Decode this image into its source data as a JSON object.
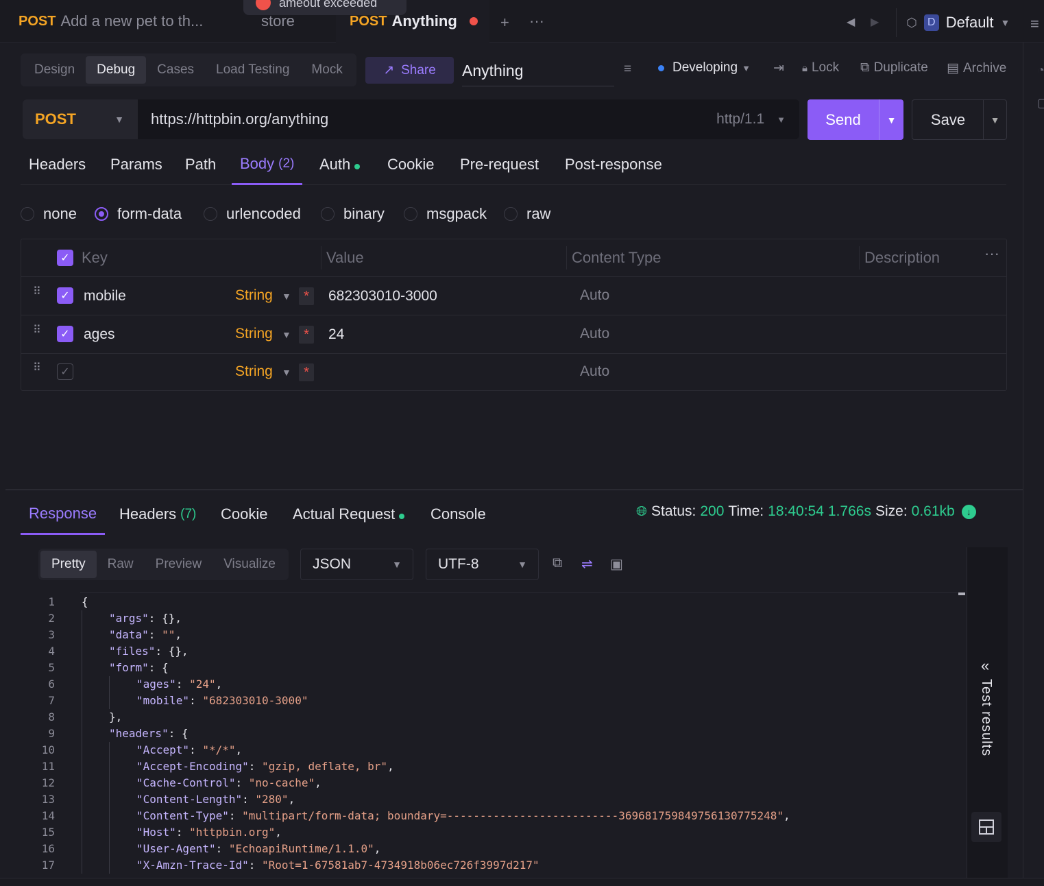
{
  "tabs": [
    {
      "method": "POST",
      "title": "Add a new pet to th...",
      "active": false
    },
    {
      "method": "",
      "title": "store",
      "active": false
    },
    {
      "method": "POST",
      "title": "Anything",
      "active": true,
      "unsaved": true
    }
  ],
  "toast": {
    "text": "ameout exceeded"
  },
  "environment": {
    "badge": "D",
    "name": "Default"
  },
  "modes": [
    "Design",
    "Debug",
    "Cases",
    "Load Testing",
    "Mock"
  ],
  "active_mode": "Debug",
  "share_label": "Share",
  "request_name": "Anything",
  "toolbar": {
    "status": "Developing",
    "lock": "Lock",
    "duplicate": "Duplicate",
    "archive": "Archive"
  },
  "url_bar": {
    "method": "POST",
    "url": "https://httpbin.org/anything",
    "protocol": "http/1.1",
    "send": "Send",
    "save": "Save"
  },
  "request_tabs": [
    {
      "label": "Headers"
    },
    {
      "label": "Params"
    },
    {
      "label": "Path"
    },
    {
      "label": "Body",
      "count": "(2)",
      "active": true
    },
    {
      "label": "Auth",
      "dot": true
    },
    {
      "label": "Cookie"
    },
    {
      "label": "Pre-request"
    },
    {
      "label": "Post-response"
    }
  ],
  "body_types": [
    "none",
    "form-data",
    "urlencoded",
    "binary",
    "msgpack",
    "raw"
  ],
  "body_type_selected": "form-data",
  "form_table": {
    "headers": {
      "key": "Key",
      "value": "Value",
      "content_type": "Content Type",
      "description": "Description"
    },
    "rows": [
      {
        "checked": true,
        "key": "mobile",
        "type": "String",
        "value": "682303010-3000",
        "content_type": "Auto"
      },
      {
        "checked": true,
        "key": "ages",
        "type": "String",
        "value": "24",
        "content_type": "Auto"
      },
      {
        "checked": false,
        "key": "",
        "type": "String",
        "value": "",
        "content_type": "Auto"
      }
    ]
  },
  "response_tabs": [
    {
      "label": "Response",
      "active": true
    },
    {
      "label": "Headers",
      "count": "(7)"
    },
    {
      "label": "Cookie"
    },
    {
      "label": "Actual Request",
      "dot": true
    },
    {
      "label": "Console"
    }
  ],
  "status_bar": {
    "status_label": "Status:",
    "status": "200",
    "time_label": "Time:",
    "time": "18:40:54",
    "duration": "1.766s",
    "size_label": "Size:",
    "size": "0.61kb"
  },
  "view_modes": [
    "Pretty",
    "Raw",
    "Preview",
    "Visualize"
  ],
  "active_view": "Pretty",
  "format": "JSON",
  "encoding": "UTF-8",
  "test_results_label": "Test results",
  "colors": {
    "accent": "#8b5cf6",
    "method": "#f5a524",
    "success": "#2ecc8f",
    "danger": "#f0524a"
  },
  "code_lines": [
    {
      "n": "1",
      "indent": 0,
      "parts": [
        [
          "p",
          "{"
        ]
      ]
    },
    {
      "n": "2",
      "indent": 1,
      "parts": [
        [
          "k",
          "\"args\""
        ],
        [
          "p",
          ": {},"
        ]
      ]
    },
    {
      "n": "3",
      "indent": 1,
      "parts": [
        [
          "k",
          "\"data\""
        ],
        [
          "p",
          ": "
        ],
        [
          "s",
          "\"\""
        ],
        [
          "p",
          ","
        ]
      ]
    },
    {
      "n": "4",
      "indent": 1,
      "parts": [
        [
          "k",
          "\"files\""
        ],
        [
          "p",
          ": {},"
        ]
      ]
    },
    {
      "n": "5",
      "indent": 1,
      "parts": [
        [
          "k",
          "\"form\""
        ],
        [
          "p",
          ": {"
        ]
      ]
    },
    {
      "n": "6",
      "indent": 2,
      "parts": [
        [
          "k",
          "\"ages\""
        ],
        [
          "p",
          ": "
        ],
        [
          "s",
          "\"24\""
        ],
        [
          "p",
          ","
        ]
      ]
    },
    {
      "n": "7",
      "indent": 2,
      "parts": [
        [
          "k",
          "\"mobile\""
        ],
        [
          "p",
          ": "
        ],
        [
          "s",
          "\"682303010-3000\""
        ]
      ]
    },
    {
      "n": "8",
      "indent": 1,
      "parts": [
        [
          "p",
          "},"
        ]
      ]
    },
    {
      "n": "9",
      "indent": 1,
      "parts": [
        [
          "k",
          "\"headers\""
        ],
        [
          "p",
          ": {"
        ]
      ]
    },
    {
      "n": "10",
      "indent": 2,
      "parts": [
        [
          "k",
          "\"Accept\""
        ],
        [
          "p",
          ": "
        ],
        [
          "s",
          "\"*/*\""
        ],
        [
          "p",
          ","
        ]
      ]
    },
    {
      "n": "11",
      "indent": 2,
      "parts": [
        [
          "k",
          "\"Accept-Encoding\""
        ],
        [
          "p",
          ": "
        ],
        [
          "s",
          "\"gzip, deflate, br\""
        ],
        [
          "p",
          ","
        ]
      ]
    },
    {
      "n": "12",
      "indent": 2,
      "parts": [
        [
          "k",
          "\"Cache-Control\""
        ],
        [
          "p",
          ": "
        ],
        [
          "s",
          "\"no-cache\""
        ],
        [
          "p",
          ","
        ]
      ]
    },
    {
      "n": "13",
      "indent": 2,
      "parts": [
        [
          "k",
          "\"Content-Length\""
        ],
        [
          "p",
          ": "
        ],
        [
          "s",
          "\"280\""
        ],
        [
          "p",
          ","
        ]
      ]
    },
    {
      "n": "14",
      "indent": 2,
      "parts": [
        [
          "k",
          "\"Content-Type\""
        ],
        [
          "p",
          ": "
        ],
        [
          "s",
          "\"multipart/form-data; boundary=--------------------------369681759849756130775248\""
        ],
        [
          "p",
          ","
        ]
      ]
    },
    {
      "n": "15",
      "indent": 2,
      "parts": [
        [
          "k",
          "\"Host\""
        ],
        [
          "p",
          ": "
        ],
        [
          "s",
          "\"httpbin.org\""
        ],
        [
          "p",
          ","
        ]
      ]
    },
    {
      "n": "16",
      "indent": 2,
      "parts": [
        [
          "k",
          "\"User-Agent\""
        ],
        [
          "p",
          ": "
        ],
        [
          "s",
          "\"EchoapiRuntime/1.1.0\""
        ],
        [
          "p",
          ","
        ]
      ]
    },
    {
      "n": "17",
      "indent": 2,
      "parts": [
        [
          "k",
          "\"X-Amzn-Trace-Id\""
        ],
        [
          "p",
          ": "
        ],
        [
          "s",
          "\"Root=1-67581ab7-4734918b06ec726f3997d217\""
        ]
      ]
    }
  ]
}
